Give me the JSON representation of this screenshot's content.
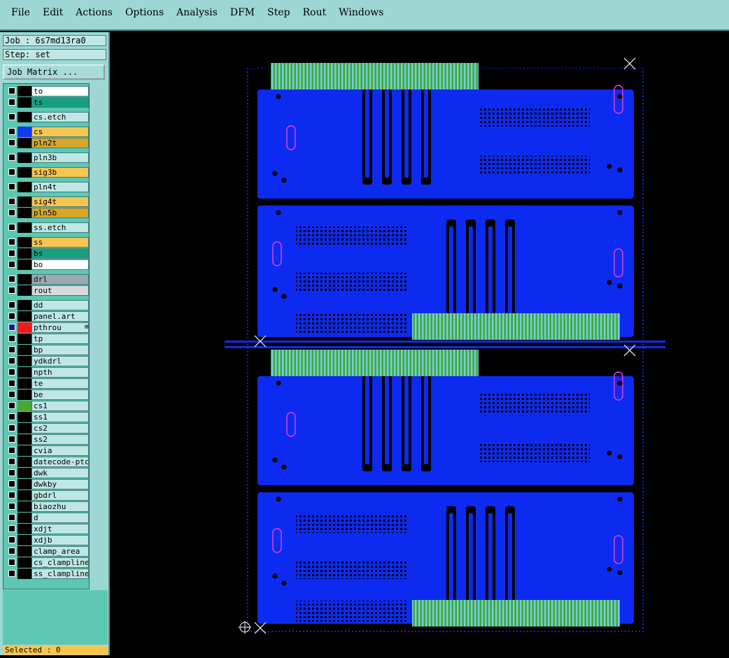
{
  "menu": [
    "File",
    "Edit",
    "Actions",
    "Options",
    "Analysis",
    "DFM",
    "Step",
    "Rout",
    "Windows"
  ],
  "job": "Job : 6s7md13ra0",
  "step": "Step: set",
  "job_matrix_label": "Job Matrix ...",
  "layers": [
    {
      "name": "to",
      "color": "white"
    },
    {
      "name": "ts",
      "color": "teal"
    },
    {
      "name": "cs.etch",
      "color": "default"
    },
    {
      "name": "cs",
      "color": "amber",
      "swatch": "blue"
    },
    {
      "name": "pln2t",
      "color": "gold"
    },
    {
      "name": "pln3b",
      "color": "default"
    },
    {
      "name": "sig3b",
      "color": "amber"
    },
    {
      "name": "pln4t",
      "color": "default"
    },
    {
      "name": "sig4t",
      "color": "amber"
    },
    {
      "name": "pln5b",
      "color": "gold"
    },
    {
      "name": "ss.etch",
      "color": "default"
    },
    {
      "name": "ss",
      "color": "amber"
    },
    {
      "name": "bs",
      "color": "teal"
    },
    {
      "name": "bo",
      "color": "white"
    },
    {
      "name": "drl",
      "color": "gray"
    },
    {
      "name": "rout",
      "color": "lgray"
    },
    {
      "name": "dd",
      "color": "default"
    },
    {
      "name": "panel.art",
      "color": "default"
    },
    {
      "name": "pthrou",
      "color": "default",
      "swatch": "red",
      "active": true,
      "more": "⊞"
    },
    {
      "name": "tp",
      "color": "default"
    },
    {
      "name": "bp",
      "color": "default"
    },
    {
      "name": "ydkdrl",
      "color": "default"
    },
    {
      "name": "npth",
      "color": "default"
    },
    {
      "name": "te",
      "color": "default"
    },
    {
      "name": "be",
      "color": "default"
    },
    {
      "name": "cs1",
      "color": "default",
      "swatch": "green"
    },
    {
      "name": "ss1",
      "color": "default"
    },
    {
      "name": "cs2",
      "color": "default"
    },
    {
      "name": "ss2",
      "color": "default"
    },
    {
      "name": "cvia",
      "color": "default"
    },
    {
      "name": "datecode-ptc",
      "color": "default"
    },
    {
      "name": "dwk",
      "color": "default"
    },
    {
      "name": "dwkby",
      "color": "default"
    },
    {
      "name": "gbdrl",
      "color": "default"
    },
    {
      "name": "biaozhu",
      "color": "default"
    },
    {
      "name": "d",
      "color": "default"
    },
    {
      "name": "xdjt",
      "color": "default"
    },
    {
      "name": "xdjb",
      "color": "default"
    },
    {
      "name": "clamp_area",
      "color": "default"
    },
    {
      "name": "cs_clampline",
      "color": "default"
    },
    {
      "name": "ss_clampline",
      "color": "default"
    }
  ],
  "status": "Selected : 0",
  "colors": {
    "panel_bg": "#9dd7d3",
    "copper": "#0d2bf0",
    "finger_green": "#47a52e",
    "finger_cyan": "#6fd0e0",
    "drill_magenta": "#e040e0"
  },
  "icons": {
    "marker": "x-marker-icon",
    "origin": "origin-target-icon"
  }
}
